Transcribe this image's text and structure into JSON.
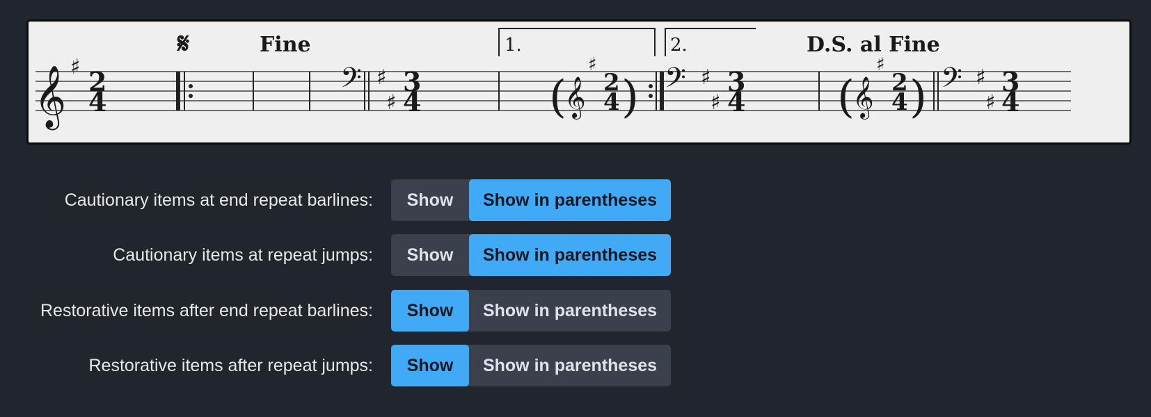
{
  "score": {
    "segno_glyph": "𝄋",
    "fine": "Fine",
    "ending_1": "1.",
    "ending_2": "2.",
    "ds_al_fine": "D.S. al Fine",
    "time_sig_first": [
      "2",
      "4"
    ],
    "time_sig_second": [
      "3",
      "4"
    ],
    "cautionary_time_sig": [
      "2",
      "4"
    ],
    "treble_clef_glyph": "𝄞",
    "bass_clef_glyph": "𝄢",
    "sharp_glyph": "♯",
    "paren_open": "(",
    "paren_close": ")"
  },
  "settings": [
    {
      "label": "Cautionary items at end repeat barlines:",
      "options": [
        "Show",
        "Show in parentheses"
      ],
      "selected": "Show in parentheses"
    },
    {
      "label": "Cautionary items at repeat jumps:",
      "options": [
        "Show",
        "Show in parentheses"
      ],
      "selected": "Show in parentheses"
    },
    {
      "label": "Restorative items after end repeat barlines:",
      "options": [
        "Show",
        "Show in parentheses"
      ],
      "selected": "Show"
    },
    {
      "label": "Restorative items after repeat jumps:",
      "options": [
        "Show",
        "Show in parentheses"
      ],
      "selected": "Show"
    }
  ],
  "colors": {
    "accent": "#40aaf7",
    "background": "#21262c",
    "segment_bg": "#3a414c"
  }
}
